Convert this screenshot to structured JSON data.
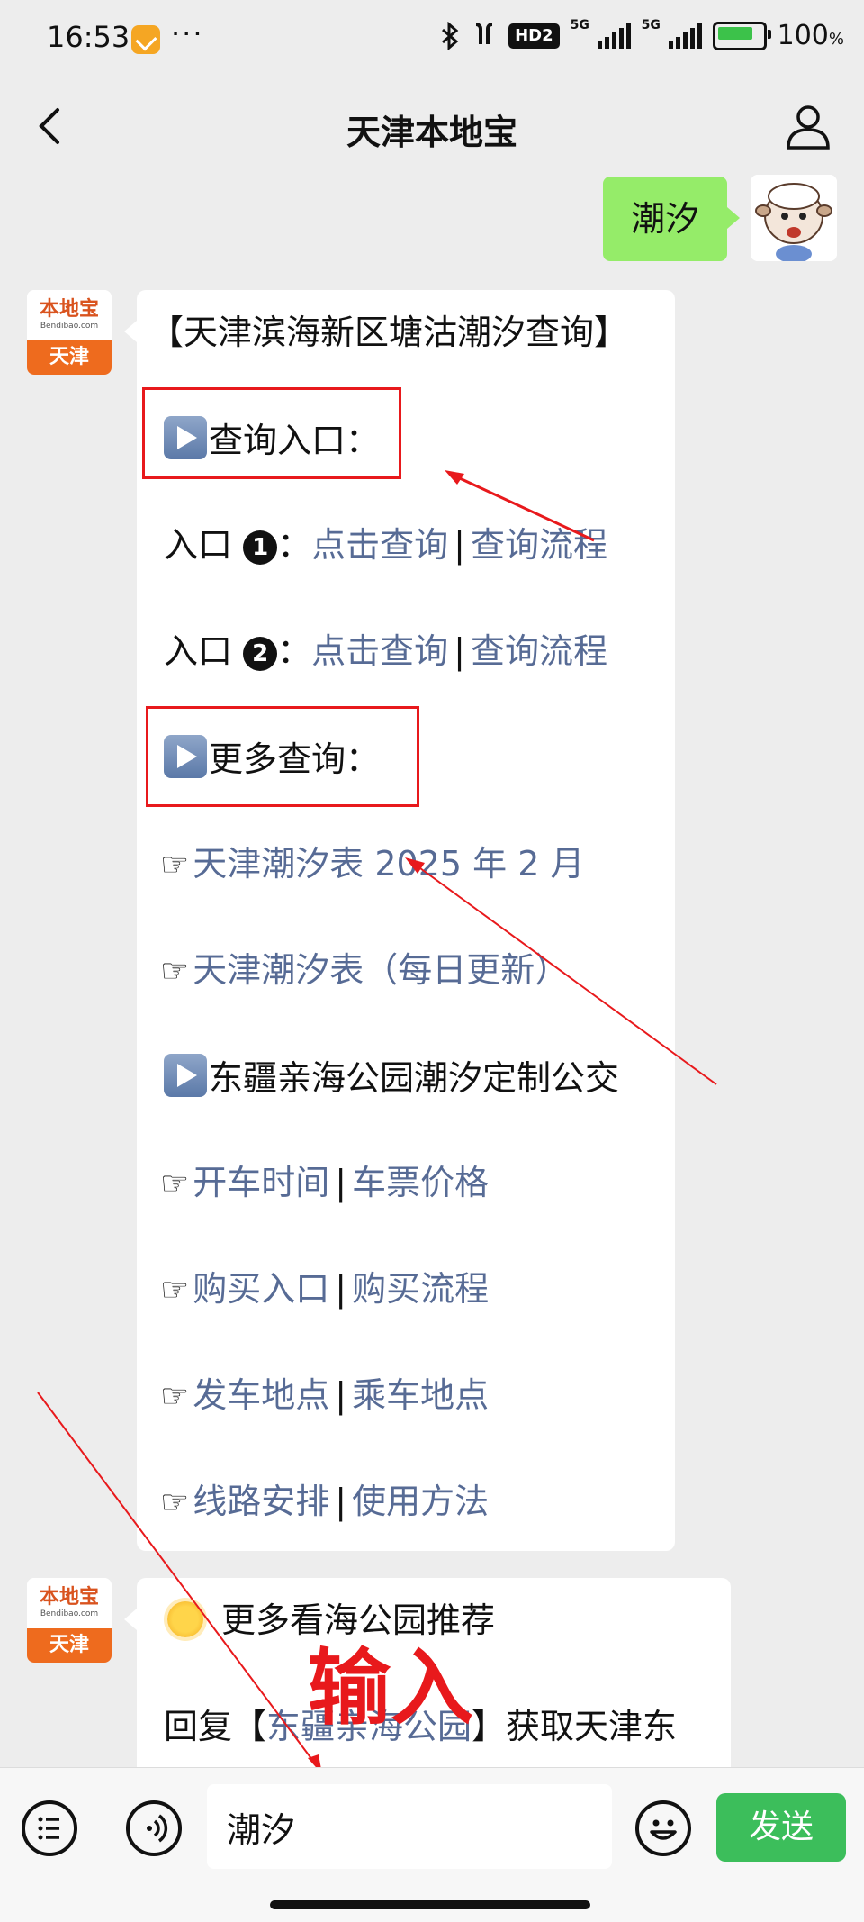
{
  "status_bar": {
    "time": "16:53",
    "dots": "···",
    "hd_label": "HD2",
    "signal1_label": "5G",
    "signal2_label": "5G",
    "battery_text": "100",
    "battery_unit": "%"
  },
  "nav": {
    "title": "天津本地宝"
  },
  "sent_message": {
    "text": "潮汐"
  },
  "bot_avatar": {
    "brand": "本地宝",
    "url": "Bendibao.com",
    "city": "天津"
  },
  "main_message": {
    "header": "【天津滨海新区塘沽潮汐查询】",
    "section_entry": "查询入口：",
    "entry1": {
      "prefix": "入口",
      "num": "1",
      "colon": "：",
      "link1": "点击查询",
      "sep": "|",
      "link2": "查询流程"
    },
    "entry2": {
      "prefix": "入口",
      "num": "2",
      "colon": "：",
      "link1": "点击查询",
      "sep": "|",
      "link2": "查询流程"
    },
    "section_more": "更多查询：",
    "more1": "天津潮汐表 2025 年 2 月",
    "more2": "天津潮汐表（每日更新）",
    "section_bus": "东疆亲海公园潮汐定制公交",
    "bus_links": [
      {
        "a": "开车时间",
        "sep": "|",
        "b": "车票价格"
      },
      {
        "a": "购买入口",
        "sep": "|",
        "b": "购买流程"
      },
      {
        "a": "发车地点",
        "sep": "|",
        "b": "乘车地点"
      },
      {
        "a": "线路安排",
        "sep": "|",
        "b": "使用方法"
      }
    ],
    "hand_glyph": "☞"
  },
  "second_message": {
    "line1": "更多看海公园推荐",
    "line2_prefix": "回复【",
    "line2_link": "东疆亲海公园",
    "line2_suffix": "】获取天津东"
  },
  "annotation": {
    "text": "输入",
    "color": "#e8191c"
  },
  "input_bar": {
    "value": "潮汐",
    "send_label": "发送"
  },
  "colors": {
    "accent_green": "#3cbe5b",
    "bubble_green": "#95ec69",
    "link_blue": "#576b95"
  }
}
